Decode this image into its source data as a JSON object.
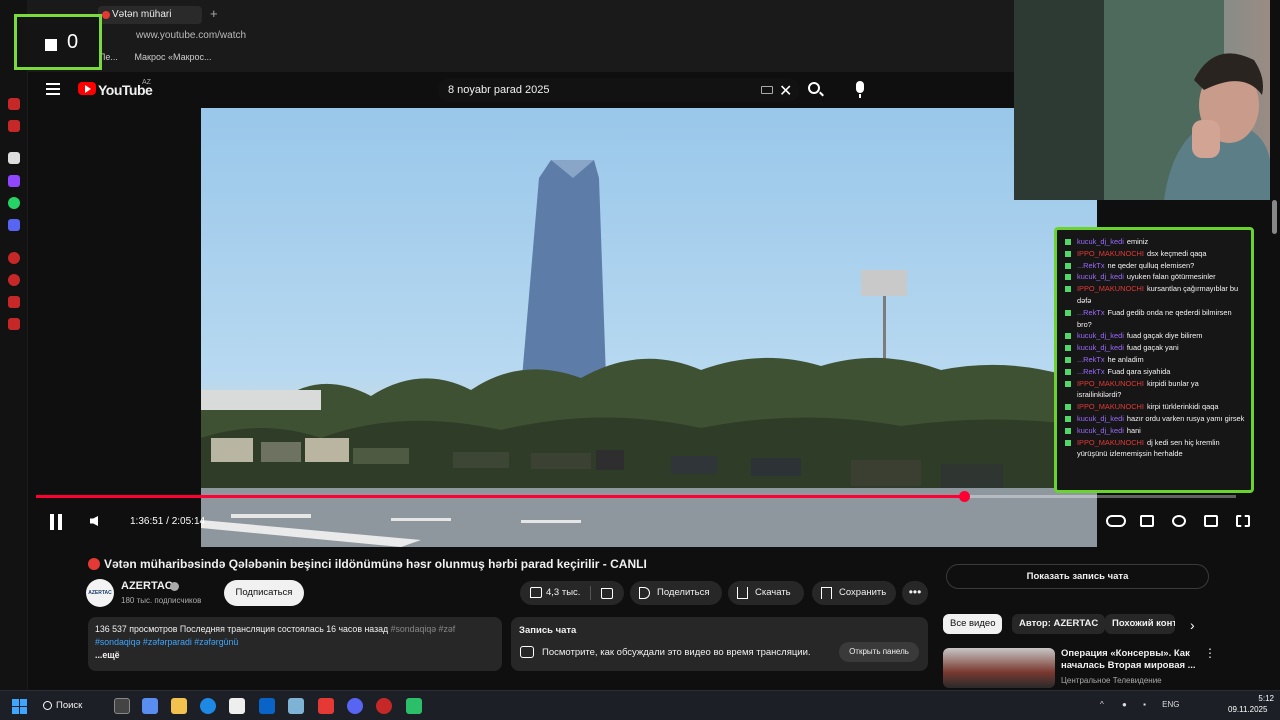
{
  "browser": {
    "tab_title": "Vətən mühari",
    "new_tab": "+",
    "url": "www.youtube.com/watch",
    "bookmarks": [
      "...Ле...",
      "Макрос «Макрос..."
    ]
  },
  "counter_overlay": {
    "value": "0"
  },
  "youtube": {
    "logo_text": "YouTube",
    "region": "AZ",
    "search_query": "8 noyabr parad 2025",
    "clear_symbol": "✕"
  },
  "player": {
    "time": "1:36:51 / 2:05:14",
    "progress_fraction": 0.773
  },
  "video": {
    "title": "Vətən müharibəsində Qələbənin beşinci ildönümünə həsr olunmuş hərbi parad keçirilir - CANLI",
    "channel_name": "AZERTAC",
    "avatar_text": "AZERTAC",
    "subscribers": "180 тыс. подписчиков",
    "subscribe_label": "Подписаться",
    "likes": "4,3 тыс.",
    "share_label": "Поделиться",
    "download_label": "Скачать",
    "save_label": "Сохранить",
    "more_symbol": "•••"
  },
  "description": {
    "stats": "136 537 просмотров  Последняя трансляция состоялась 16 часов назад",
    "hashtags_line1_inline": "#sondaqiqə #zəf",
    "hashtags_line2": "#sondaqiqə #zəfərparadi #zəfərgünü",
    "more_label": "...ещё"
  },
  "chat_replay": {
    "title": "Запись чата",
    "text": "Посмотрите, как обсуждали это видео во время трансляции.",
    "open_button": "Открыть панель"
  },
  "right_column": {
    "show_chat_button": "Показать запись чата",
    "chips": [
      "Все видео",
      "Автор: AZERTAC",
      "Похожий конте"
    ],
    "chips_next": "›",
    "recommendation": {
      "title": "Операция «Консервы». Как началась Вторая мировая ...",
      "channel": "Центральное Телевидение",
      "more": "⋮"
    }
  },
  "stream_chat": [
    {
      "user": "kucuk_dj_kedi",
      "text": "eminiz",
      "color": "#9b6bff"
    },
    {
      "user": "IPPO_MAKUNOCHI",
      "text": "dsx keçmedi qaqa",
      "color": "#e53935"
    },
    {
      "user": "...RekTx",
      "text": "ne qeder qulluq elemisen?",
      "color": "#9b6bff"
    },
    {
      "user": "kucuk_dj_kedi",
      "text": "uyuken falan götürmesinler",
      "color": "#9b6bff"
    },
    {
      "user": "IPPO_MAKUNOCHI",
      "text": "kursantlan çağırmayıblar bu dəfə",
      "color": "#e53935"
    },
    {
      "user": "...RekTx",
      "text": "Fuad gedib onda ne qederdi bilmirsen bro?",
      "color": "#9b6bff"
    },
    {
      "user": "kucuk_dj_kedi",
      "text": "fuad gaçak diye bilirem",
      "color": "#9b6bff"
    },
    {
      "user": "kucuk_dj_kedi",
      "text": "fuad gaçak yani",
      "color": "#9b6bff"
    },
    {
      "user": "...RekTx",
      "text": "he anladim",
      "color": "#9b6bff"
    },
    {
      "user": "...RekTx",
      "text": "Fuad qara siyahida",
      "color": "#9b6bff"
    },
    {
      "user": "IPPO_MAKUNOCHI",
      "text": "kirpidi bunlar ya israilinkilərdi?",
      "color": "#e53935"
    },
    {
      "user": "IPPO_MAKUNOCHI",
      "text": "kirpi türklerinkidi qaqa",
      "color": "#e53935"
    },
    {
      "user": "kucuk_dj_kedi",
      "text": "hazır ordu varken rusya yamı girsek",
      "color": "#9b6bff"
    },
    {
      "user": "kucuk_dj_kedi",
      "text": "hani",
      "color": "#9b6bff"
    },
    {
      "user": "IPPO_MAKUNOCHI",
      "text": "dj kedi sen hiç kremlin yürüşünü izlememişsin herhalde",
      "color": "#e53935"
    }
  ],
  "taskbar": {
    "search_label": "Поиск",
    "language": "ENG",
    "time": "5:12",
    "date": "09.11.2025"
  },
  "colors": {
    "accent_red": "#ff0033",
    "chat_border": "#6ad32e",
    "hashtag": "#3ea6ff"
  }
}
